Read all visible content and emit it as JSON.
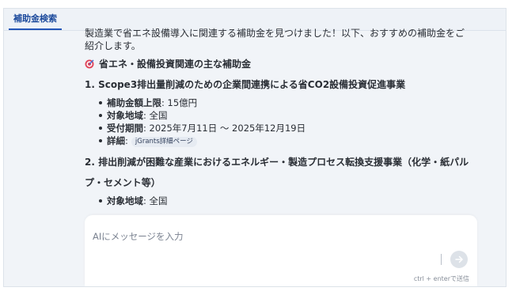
{
  "tabs": [
    {
      "label": "補助金検索",
      "active": true
    }
  ],
  "message": {
    "intro": "製造業で省エネ設備導入に関連する補助金を見つけました！以下、おすすめの補助金をご紹介します。",
    "heading_icon": "target-icon",
    "heading": "省エネ・設備投資関連の主な補助金",
    "items": [
      {
        "title": "1. Scope3排出量削減のための企業間連携による省CO2設備投資促進事業",
        "max_amount_label": "補助金額上限",
        "max_amount": ": 15億円",
        "region_label": "対象地域",
        "region": ": 全国",
        "period_label": "受付期間",
        "period": ": 2025年7月11日 ～ 2025年12月19日",
        "detail_label": "詳細",
        "detail_sep": ":",
        "detail_link": "jGrants詳細ページ"
      },
      {
        "title": "2. 排出削減が困難な産業におけるエネルギー・製造プロセス転換支援事業（化学・紙パルプ・セメント等）",
        "region_label": "対象地域",
        "region": ": 全国"
      }
    ]
  },
  "input": {
    "placeholder": "AIにメッセージを入力",
    "send_icon": "arrow-right-icon",
    "hint": "ctrl + enterで送信"
  },
  "colors": {
    "accent": "#2456b8",
    "background": "#f1f4f8",
    "send_button": "#dde2e8"
  }
}
